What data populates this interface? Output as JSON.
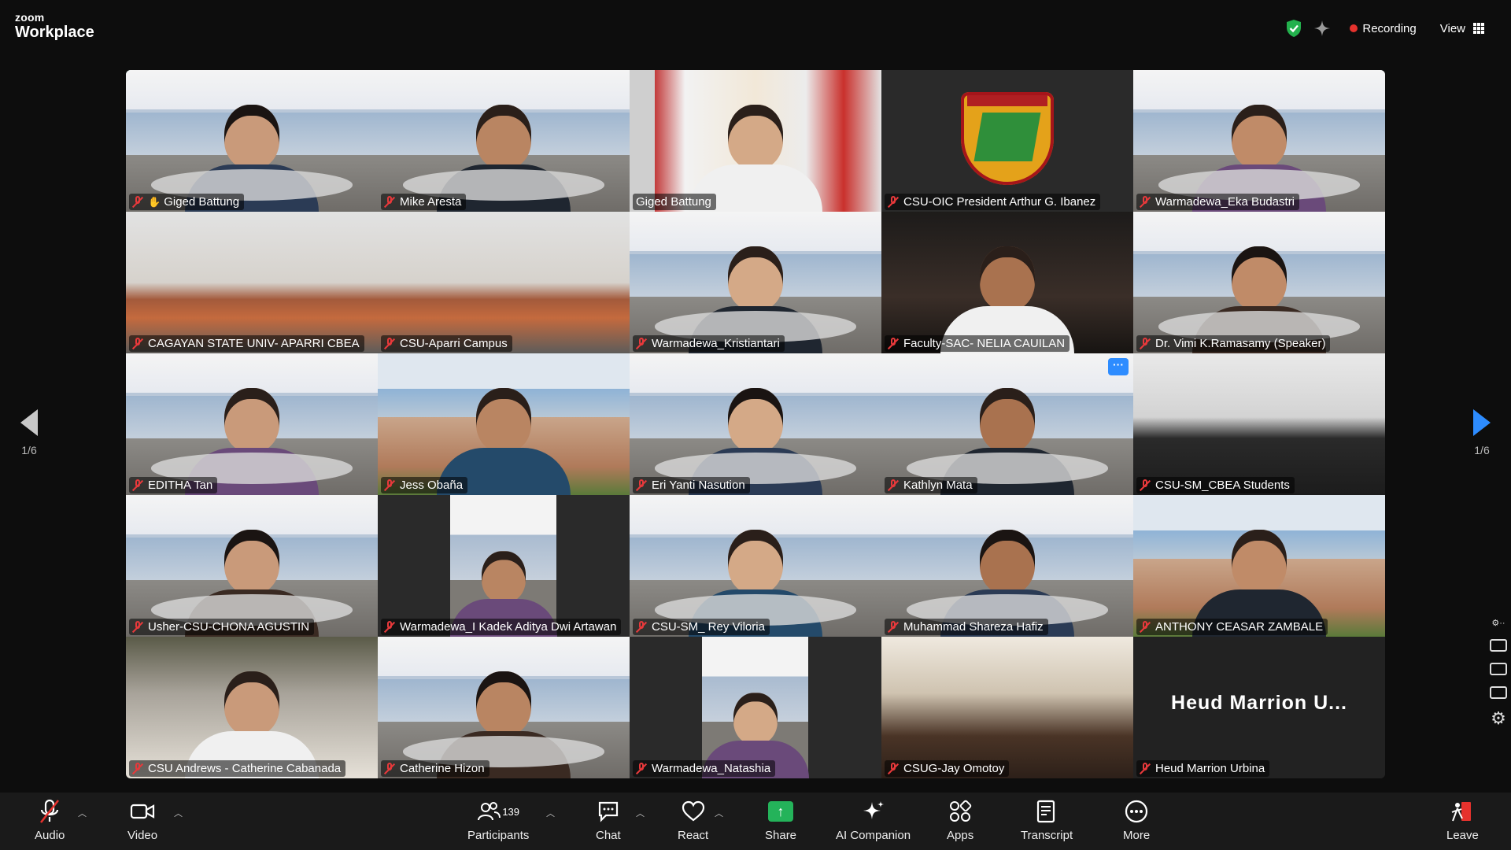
{
  "app": {
    "brand_line1": "zoom",
    "brand_line2": "Workplace"
  },
  "topbar": {
    "recording": "Recording",
    "view": "View",
    "recording_color": "#e5322d",
    "security_color": "#23b14d"
  },
  "pager": {
    "left": "1/6",
    "right": "1/6"
  },
  "tiles": [
    {
      "name": "Giged Battung",
      "scene": "banner",
      "active": true,
      "hand": true
    },
    {
      "name": "Mike Aresta",
      "scene": "banner"
    },
    {
      "name": "Giged Battung",
      "scene": "flags",
      "muted": false
    },
    {
      "name": "CSU-OIC President Arthur G. Ibanez",
      "scene": "logo"
    },
    {
      "name": "Warmadewa_Eka Budastri",
      "scene": "banner"
    },
    {
      "name": "CAGAYAN STATE UNIV- APARRI CBEA",
      "scene": "office"
    },
    {
      "name": "CSU-Aparri Campus",
      "scene": "office"
    },
    {
      "name": "Warmadewa_Kristiantari",
      "scene": "banner"
    },
    {
      "name": "Faculty-SAC- NELIA CAUILAN",
      "scene": "darkwarm"
    },
    {
      "name": "Dr. Vimi K.Ramasamy (Speaker)",
      "scene": "banner"
    },
    {
      "name": "EDITHA Tan",
      "scene": "banner"
    },
    {
      "name": "Jess Obaña",
      "scene": "campus"
    },
    {
      "name": "Eri Yanti Nasution",
      "scene": "banner"
    },
    {
      "name": "Kathlyn Mata",
      "scene": "banner",
      "more": "···"
    },
    {
      "name": "CSU-SM_CBEA Students",
      "scene": "classroom"
    },
    {
      "name": "Usher-CSU-CHONA AGUSTIN",
      "scene": "banner"
    },
    {
      "name": "Warmadewa_I Kadek Aditya Dwi Artawan",
      "scene": "pip"
    },
    {
      "name": "CSU-SM_ Rey Viloria",
      "scene": "banner"
    },
    {
      "name": "Muhammad Shareza Hafiz",
      "scene": "banner"
    },
    {
      "name": "ANTHONY CEASAR ZAMBALE",
      "scene": "campus"
    },
    {
      "name": "CSU Andrews - Catherine Cabanada",
      "scene": "plant"
    },
    {
      "name": "Catherine Hizon",
      "scene": "banner"
    },
    {
      "name": "Warmadewa_Natashia",
      "scene": "pip"
    },
    {
      "name": "CSUG-Jay Omotoy",
      "scene": "boardroom"
    },
    {
      "name": "Heud Marrion Urbina",
      "scene": "namecard",
      "display": "Heud Marrion U..."
    }
  ],
  "toolbar": {
    "audio": "Audio",
    "video": "Video",
    "participants": "Participants",
    "participants_count": "139",
    "chat": "Chat",
    "react": "React",
    "share": "Share",
    "ai_companion": "AI Companion",
    "apps": "Apps",
    "transcript": "Transcript",
    "more": "More",
    "leave": "Leave",
    "share_color": "#24b35a",
    "leave_color": "#e5322d"
  }
}
